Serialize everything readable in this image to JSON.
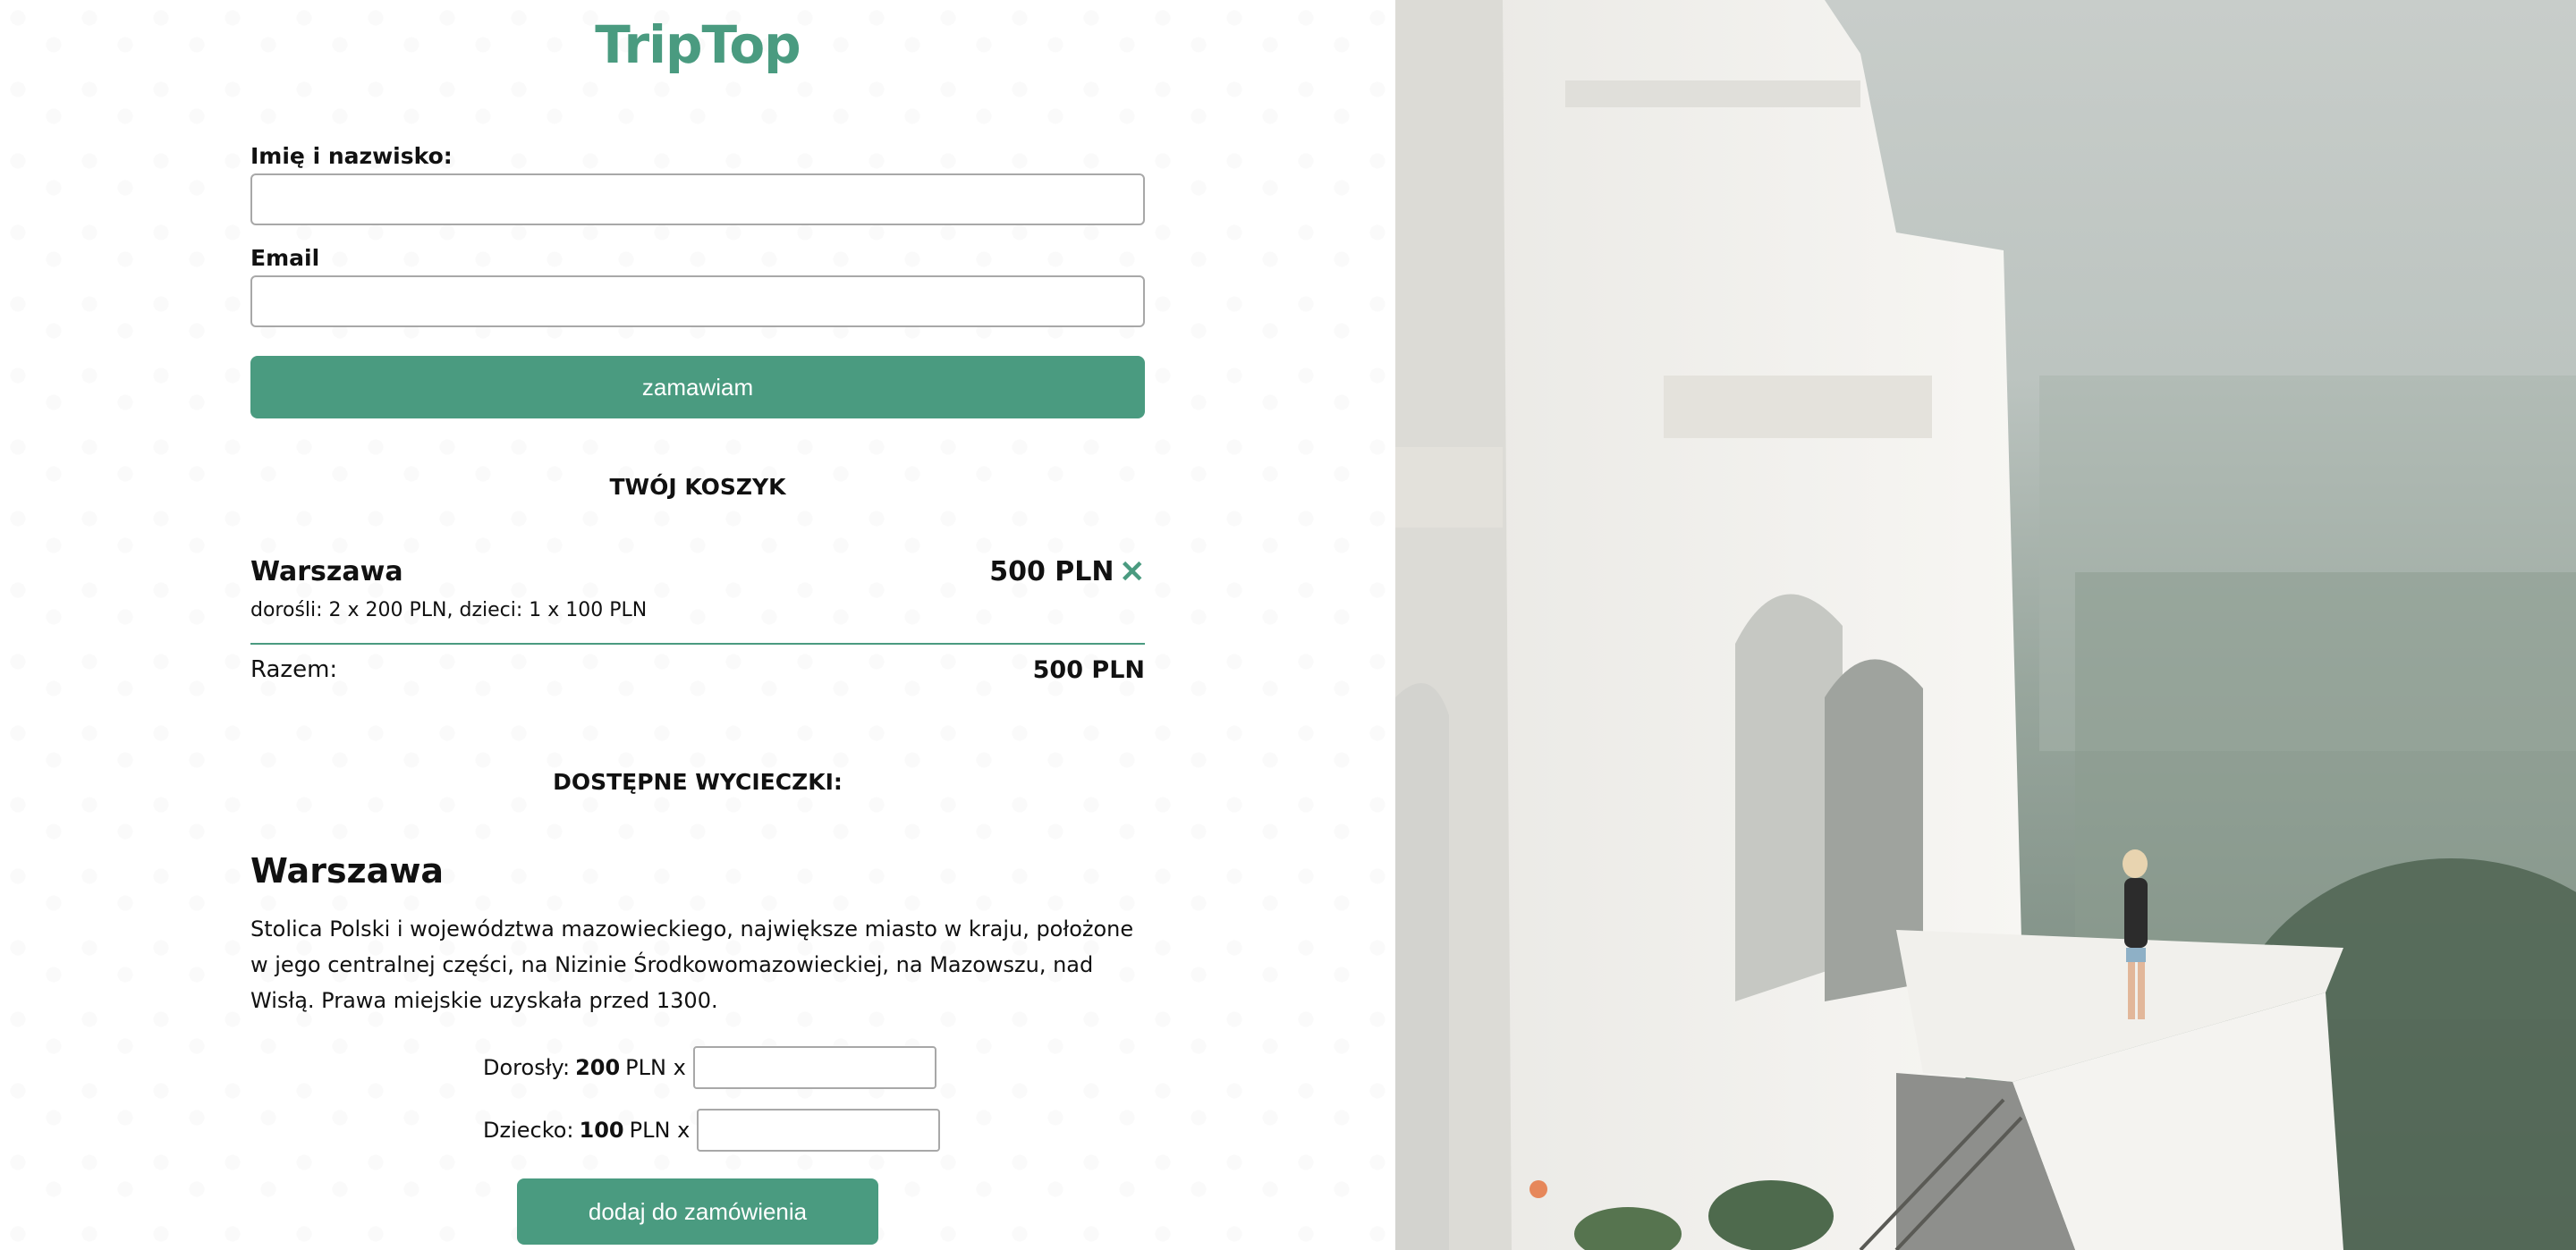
{
  "brand": {
    "logo": "TripTop"
  },
  "form": {
    "name_label": "Imię i nazwisko:",
    "name_value": "",
    "email_label": "Email",
    "email_value": "",
    "submit_label": "zamawiam"
  },
  "cart": {
    "heading": "TWÓJ KOSZYK",
    "items": [
      {
        "name": "Warszawa",
        "price": "500 PLN",
        "details": "dorośli: 2 x 200 PLN, dzieci: 1 x 100 PLN"
      }
    ],
    "total_label": "Razem:",
    "total_value": "500 PLN"
  },
  "trips": {
    "heading": "DOSTĘPNE WYCIECZKI:",
    "items": [
      {
        "title": "Warszawa",
        "description": "Stolica Polski i województwa mazowieckiego, największe miasto w kraju, położone w jego centralnej części, na Nizinie Środkowomazowieckiej, na Mazowszu, nad Wisłą. Prawa miejskie uzyskała przed 1300.",
        "adult_label": "Dorosły:",
        "adult_price": "200",
        "child_label": "Dziecko:",
        "child_price": "100",
        "currency_suffix": "PLN x",
        "add_label": "dodaj do zamówienia"
      }
    ]
  },
  "colors": {
    "accent": "#4a9b80"
  },
  "icons": {
    "remove": "close-icon"
  }
}
